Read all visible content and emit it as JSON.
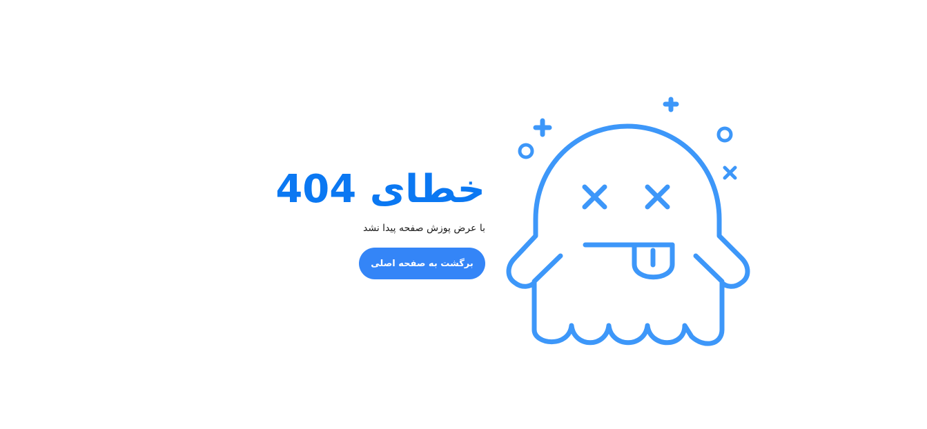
{
  "error": {
    "title": "خطای 404",
    "message": "با عرض پوزش صفحه پیدا نشد",
    "home_button_label": "برگشت به صفحه اصلی"
  },
  "illustration": {
    "icon": "dead-ghost-icon",
    "color": "#3d97f9"
  },
  "colors": {
    "title": "#0b78f2",
    "button": "#3485f7",
    "background": "#ffffff"
  }
}
